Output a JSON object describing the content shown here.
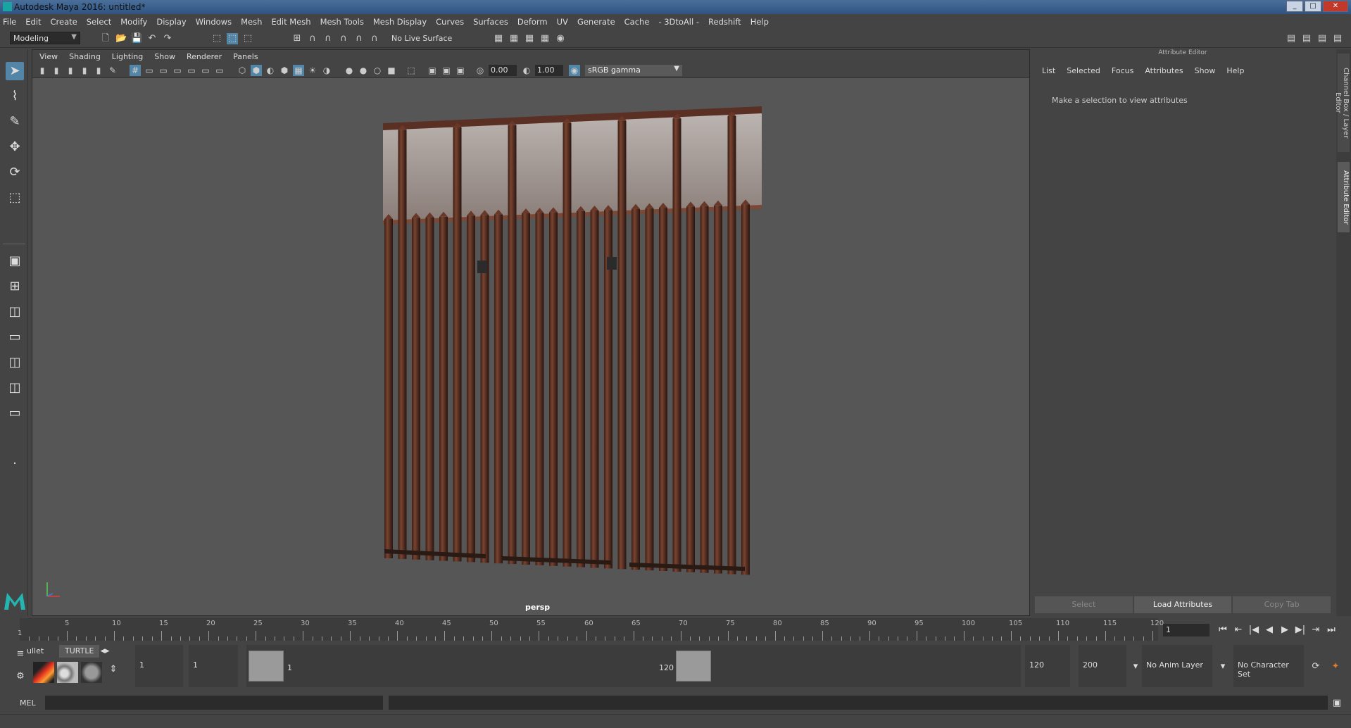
{
  "window": {
    "title": "Autodesk Maya 2016: untitled*"
  },
  "menubar": [
    "File",
    "Edit",
    "Create",
    "Select",
    "Modify",
    "Display",
    "Windows",
    "Mesh",
    "Edit Mesh",
    "Mesh Tools",
    "Mesh Display",
    "Curves",
    "Surfaces",
    "Deform",
    "UV",
    "Generate",
    "Cache",
    "- 3DtoAll -",
    "Redshift",
    "Help"
  ],
  "shelf": {
    "mode": "Modeling",
    "live_surface": "No Live Surface"
  },
  "viewport": {
    "menu": [
      "View",
      "Shading",
      "Lighting",
      "Show",
      "Renderer",
      "Panels"
    ],
    "exposure": "0.00",
    "gamma_value": "1.00",
    "color_space": "sRGB gamma",
    "camera": "persp"
  },
  "attribute_editor": {
    "header": "Attribute Editor",
    "menu": [
      "List",
      "Selected",
      "Focus",
      "Attributes",
      "Show",
      "Help"
    ],
    "message": "Make a selection to view attributes",
    "buttons": {
      "select": "Select",
      "load": "Load Attributes",
      "copy": "Copy Tab"
    }
  },
  "side_tabs": {
    "channel_box": "Channel Box / Layer Editor",
    "attribute_editor": "Attribute Editor"
  },
  "timeline": {
    "ticks": [
      "5",
      "10",
      "15",
      "20",
      "25",
      "30",
      "35",
      "40",
      "45",
      "50",
      "55",
      "60",
      "65",
      "70",
      "75",
      "80",
      "85",
      "90",
      "95",
      "100",
      "105",
      "110",
      "115",
      "120"
    ],
    "start_marker": "1",
    "current_frame": "1"
  },
  "range": {
    "shelf_tabs": [
      "ullet",
      "TURTLE"
    ],
    "start_time": "1",
    "playback_start": "1",
    "slider_start": "1",
    "slider_end": "120",
    "playback_end": "120",
    "end_time": "200",
    "anim_layer": "No Anim Layer",
    "character_set": "No Character Set"
  },
  "cmdline": {
    "label": "MEL"
  },
  "colors": {
    "accent": "#5285a6",
    "bg": "#444444",
    "viewport": "#565656",
    "rust": "#6b3a2a"
  }
}
